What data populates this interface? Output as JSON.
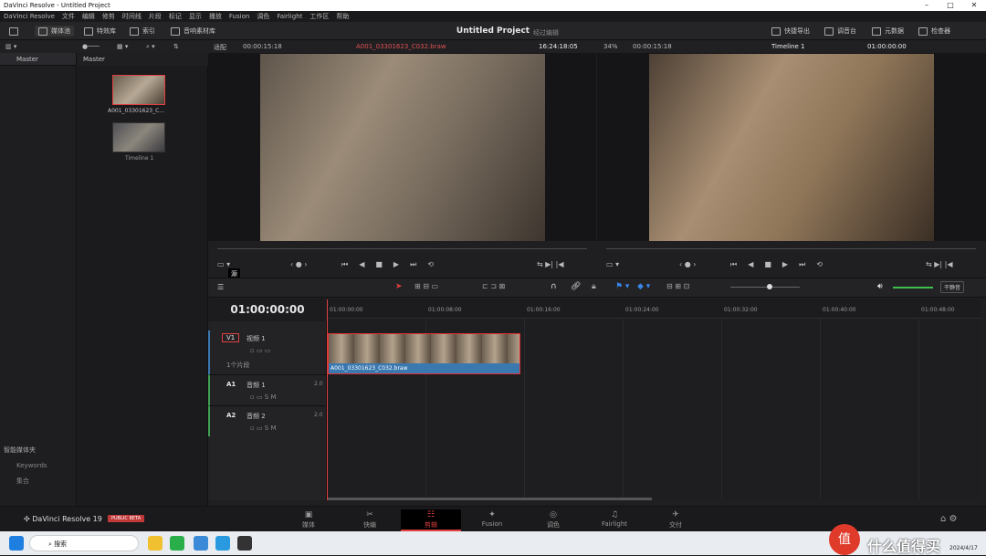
{
  "window": {
    "title": "DaVinci Resolve - Untitled Project"
  },
  "menu": [
    "DaVinci Resolve",
    "文件",
    "编辑",
    "修剪",
    "时间线",
    "片段",
    "标记",
    "显示",
    "播放",
    "Fusion",
    "调色",
    "Fairlight",
    "工作区",
    "帮助"
  ],
  "toolbar": {
    "media_pool": "媒体池",
    "effects": "特效库",
    "index": "索引",
    "sound": "音响素材库",
    "project": "Untitled Project",
    "project_sub": "经过编辑",
    "quick_export": "快捷导出",
    "mixer": "调音台",
    "metadata": "元数据",
    "inspector": "检查器"
  },
  "viewer": {
    "fit": "适配",
    "src_tc": "00:00:15:18",
    "clip_name": "A001_03301623_C032.braw",
    "rec_time": "16:24:18:05",
    "zoom": "34%",
    "tl_tc": "00:00:15:18",
    "timeline_name": "Timeline 1",
    "tl_tc2": "01:00:00:00",
    "src_label": "源"
  },
  "bins": {
    "master_left": "Master",
    "master_right": "Master",
    "smart_bins": "智能媒体夹",
    "keywords": "Keywords",
    "collections": "集合"
  },
  "media": [
    {
      "name": "A001_03301623_C..."
    },
    {
      "name": "Timeline 1"
    }
  ],
  "timeline": {
    "timecode": "01:00:00:00",
    "ruler": [
      "01:00:00:00",
      "01:00:08:00",
      "01:00:16:00",
      "01:00:24:00",
      "01:00:32:00",
      "01:00:40:00",
      "01:00:48:00"
    ],
    "tracks": [
      {
        "id": "V1",
        "name": "视频 1",
        "info": "1个片段"
      },
      {
        "id": "A1",
        "name": "音频 1",
        "ch": "2.0"
      },
      {
        "id": "A2",
        "name": "音频 2",
        "ch": "2.0"
      }
    ],
    "clip": "A001_03301623_C032.braw",
    "audio_btn": "干静音"
  },
  "bottom": {
    "app": "DaVinci Resolve 19",
    "beta": "PUBLIC BETA",
    "pages": [
      "媒体",
      "快编",
      "剪辑",
      "Fusion",
      "调色",
      "Fairlight",
      "交付"
    ],
    "active": "剪辑"
  },
  "taskbar": {
    "search": "搜索",
    "date": "2024/4/17",
    "watermark": "什么值得买"
  }
}
